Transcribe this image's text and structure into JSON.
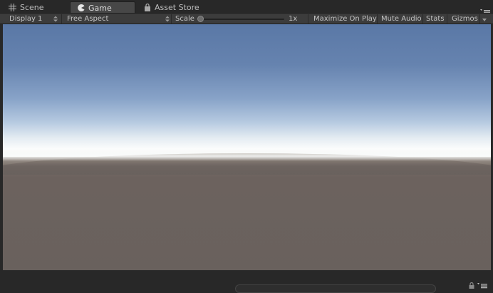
{
  "tabs": [
    {
      "label": "Scene",
      "icon": "grid-icon"
    },
    {
      "label": "Game",
      "icon": "pacman-icon",
      "active": true
    },
    {
      "label": "Asset Store",
      "icon": "store-bag-icon"
    }
  ],
  "toolbar": {
    "display": "Display 1",
    "aspect": "Free Aspect",
    "scale_label": "Scale",
    "scale_value": "1x",
    "scale_level": 0.0,
    "maximize": "Maximize On Play",
    "mute": "Mute Audio",
    "stats": "Stats",
    "gizmos": "Gizmos"
  },
  "colors": {
    "panel": "#3c3c3c",
    "background": "#282828",
    "sky_top": "#5a78a6",
    "horizon": "#fbfcfc",
    "ground": "#69615d"
  }
}
